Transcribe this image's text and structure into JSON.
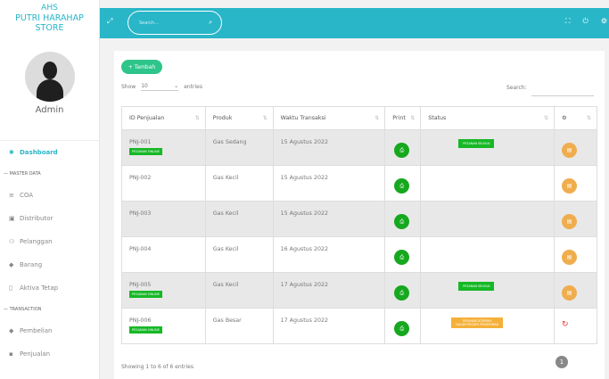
{
  "brand": {
    "line1": "AHS",
    "line2": "PUTRI HARAHAP STORE"
  },
  "profile": {
    "name": "Admin"
  },
  "sidebar": {
    "items": [
      {
        "label": "Dashboard",
        "icon": "home-icon",
        "glyph": "✱",
        "active": true
      },
      {
        "section": "— MASTER DATA"
      },
      {
        "label": "COA",
        "icon": "list-icon",
        "glyph": "≡"
      },
      {
        "label": "Distributor",
        "icon": "book-icon",
        "glyph": "▣"
      },
      {
        "label": "Pelanggan",
        "icon": "users-icon",
        "glyph": "⚇"
      },
      {
        "label": "Barang",
        "icon": "cube-icon",
        "glyph": "◆"
      },
      {
        "label": "Aktiva Tetap",
        "icon": "file-icon",
        "glyph": "▯"
      },
      {
        "section": "— TRANSACTION"
      },
      {
        "label": "Pembelian",
        "icon": "cart-icon",
        "glyph": "◆"
      },
      {
        "label": "Penjualan",
        "icon": "tag-icon",
        "glyph": "▪"
      }
    ]
  },
  "topbar": {
    "search_placeholder": "Search...",
    "icons": [
      "expand-icon",
      "search-icon",
      "fullscreen-icon",
      "power-icon",
      "settings-icon"
    ]
  },
  "main": {
    "add_label": "+ Tambah",
    "show_label": "Show",
    "entries_value": "10",
    "entries_label": "entries",
    "search_label": "Search:",
    "columns": [
      "ID Penjualan",
      "Produk",
      "Waktu Transaksi",
      "Print",
      "Status",
      "⚙"
    ],
    "rows": [
      {
        "id": "PNJ-001",
        "online": "PESANAN ONLINE",
        "produk": "Gas Sedang",
        "waktu": "15 Agustus 2022",
        "status": "PESANAN SELESAI",
        "status_type": "done",
        "action": "edit"
      },
      {
        "id": "PNJ-002",
        "online": "",
        "produk": "Gas Kecil",
        "waktu": "15 Agustus 2022",
        "status": "",
        "status_type": "",
        "action": "edit"
      },
      {
        "id": "PNJ-003",
        "online": "",
        "produk": "Gas Kecil",
        "waktu": "15 Agustus 2022",
        "status": "",
        "status_type": "",
        "action": "edit"
      },
      {
        "id": "PNJ-004",
        "online": "",
        "produk": "Gas Kecil",
        "waktu": "16 Agustus 2022",
        "status": "",
        "status_type": "",
        "action": "edit"
      },
      {
        "id": "PNJ-005",
        "online": "PESANAN ONLINE",
        "produk": "Gas Kecil",
        "waktu": "17 Agustus 2022",
        "status": "PESANAN SELESAI",
        "status_type": "done",
        "action": "edit"
      },
      {
        "id": "PNJ-006",
        "online": "PESANAN ONLINE",
        "produk": "Gas Besar",
        "waktu": "17 Agustus 2022",
        "status": "PESANAN DITERIMA\nDALAM PROSES PENGIRIMAN",
        "status_type": "proc",
        "action": "refresh"
      }
    ],
    "footer": "Showing 1 to 6 of 6 entries",
    "page": "1"
  },
  "colors": {
    "accent": "#29b6c8",
    "green": "#16b826",
    "orange": "#f0ad4e",
    "red": "#e33333"
  }
}
